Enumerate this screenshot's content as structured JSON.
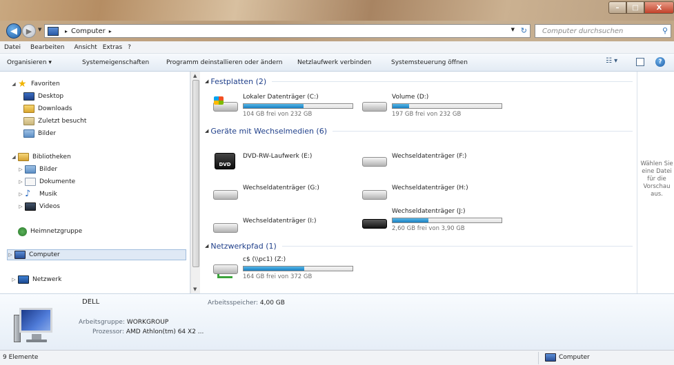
{
  "window": {
    "minimize_glyph": "–",
    "maximize_glyph": "□",
    "close_glyph": "X"
  },
  "nav": {
    "back_icon": "back-arrow",
    "forward_icon": "forward-arrow",
    "address": {
      "crumb": "Computer",
      "separator": "▸"
    },
    "search_placeholder": "Computer durchsuchen"
  },
  "menu": [
    "Datei",
    "Bearbeiten",
    "Ansicht",
    "Extras",
    "?"
  ],
  "commands": [
    {
      "label": "Organisieren ▾"
    },
    {
      "label": "Systemeigenschaften"
    },
    {
      "label": "Programm deinstallieren oder ändern"
    },
    {
      "label": "Netzlaufwerk verbinden"
    },
    {
      "label": "Systemsteuerung öffnen"
    }
  ],
  "sidebar": {
    "favorites": {
      "label": "Favoriten",
      "items": [
        "Desktop",
        "Downloads",
        "Zuletzt besucht",
        "Bilder"
      ]
    },
    "libraries": {
      "label": "Bibliotheken",
      "items": [
        "Bilder",
        "Dokumente",
        "Musik",
        "Videos"
      ]
    },
    "homegroup": "Heimnetzgruppe",
    "computer": "Computer",
    "network": "Netzwerk"
  },
  "groups": {
    "hdd": {
      "title": "Festplatten (2)"
    },
    "removable": {
      "title": "Geräte mit Wechselmedien (6)"
    },
    "network": {
      "title": "Netzwerkpfad (1)"
    }
  },
  "drives": {
    "c": {
      "name": "Lokaler Datenträger (C:)",
      "free": "104 GB frei von 232 GB",
      "used_fraction": 0.55
    },
    "d": {
      "name": "Volume (D:)",
      "free": "197 GB frei von 232 GB",
      "used_fraction": 0.15
    },
    "e": {
      "name": "DVD-RW-Laufwerk (E:)"
    },
    "f": {
      "name": "Wechseldatenträger (F:)"
    },
    "g": {
      "name": "Wechseldatenträger (G:)"
    },
    "h": {
      "name": "Wechseldatenträger (H:)"
    },
    "i": {
      "name": "Wechseldatenträger (I:)"
    },
    "j": {
      "name": "Wechseldatenträger (J:)",
      "free": "2,60 GB frei von 3,90 GB",
      "used_fraction": 0.33
    },
    "z": {
      "name": "c$ (\\\\pc1) (Z:)",
      "free": "164 GB frei von 372 GB",
      "used_fraction": 0.56
    }
  },
  "preview_text": "Wählen Sie eine Datei für die Vorschau aus.",
  "details": {
    "name": "DELL",
    "workgroup_label": "Arbeitsgruppe:",
    "workgroup_value": "WORKGROUP",
    "memory_label": "Arbeitsspeicher:",
    "memory_value": "4,00 GB",
    "processor_label": "Prozessor:",
    "processor_value": "AMD Athlon(tm) 64 X2 ..."
  },
  "status": {
    "count": "9 Elemente",
    "location": "Computer"
  },
  "colors": {
    "bar_fill": "#1a7fc0",
    "group_title": "#1f3f8a",
    "selection": "#dfe9f5"
  }
}
